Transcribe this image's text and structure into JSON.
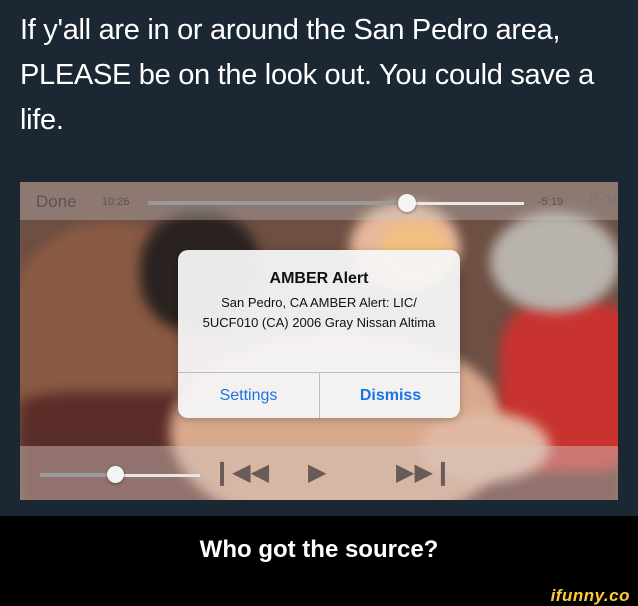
{
  "post": {
    "text": "If y'all are in or around the San Pedro area, PLEASE be on the look out. You could save a life."
  },
  "player": {
    "done_label": "Done",
    "time_elapsed": "10:26",
    "time_remaining": "-5:19",
    "scrub_progress": 0.69,
    "volume_level": 0.47,
    "icons": [
      "fullscreen-icon",
      "rewind-icon",
      "play-icon",
      "fast-forward-icon"
    ]
  },
  "alert": {
    "title": "AMBER Alert",
    "body": "San Pedro, CA AMBER Alert: LIC/ 5UCF010 (CA) 2006 Gray Nissan Altima",
    "settings_label": "Settings",
    "dismiss_label": "Dismiss",
    "button_color": "#1a73e8"
  },
  "caption": {
    "text": "Who got the source?"
  },
  "watermark": "ifunny.co",
  "colors": {
    "page_background": "#1b2733",
    "caption_background": "#000000",
    "watermark": "#ffcc33"
  }
}
